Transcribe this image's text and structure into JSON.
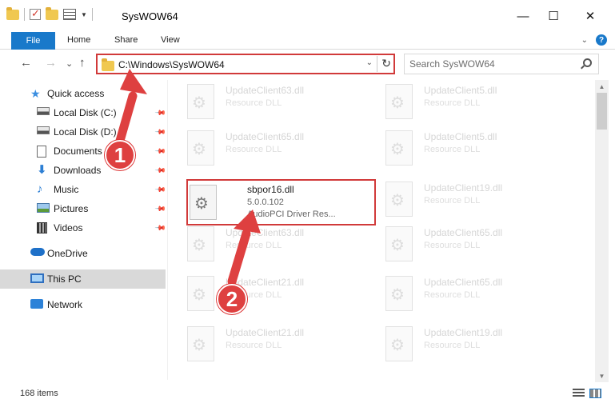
{
  "window": {
    "title": "SysWOW64",
    "minimize": "—",
    "maximize": "☐",
    "close": "✕"
  },
  "ribbon": {
    "tabs": [
      "File",
      "Home",
      "Share",
      "View"
    ],
    "expand": "⌄",
    "help": "?"
  },
  "nav": {
    "back": "←",
    "forward": "→",
    "recent": "⌄",
    "up": "↑",
    "address": "C:\\Windows\\SysWOW64",
    "refresh": "↻",
    "search_placeholder": "Search SysWOW64"
  },
  "sidebar": {
    "items": [
      {
        "label": "Quick access",
        "icon": "star-icon",
        "pinned": false
      },
      {
        "label": "Local Disk (C:)",
        "icon": "disk-icon",
        "pinned": true
      },
      {
        "label": "Local Disk (D:)",
        "icon": "disk-icon",
        "pinned": true
      },
      {
        "label": "Documents",
        "icon": "document-icon",
        "pinned": true
      },
      {
        "label": "Downloads",
        "icon": "download-icon",
        "pinned": true
      },
      {
        "label": "Music",
        "icon": "music-icon",
        "pinned": true
      },
      {
        "label": "Pictures",
        "icon": "pictures-icon",
        "pinned": true
      },
      {
        "label": "Videos",
        "icon": "videos-icon",
        "pinned": true
      },
      {
        "label": "OneDrive",
        "icon": "cloud-icon",
        "pinned": false
      },
      {
        "label": "This PC",
        "icon": "computer-icon",
        "pinned": false,
        "selected": true
      },
      {
        "label": "Network",
        "icon": "network-icon",
        "pinned": false
      }
    ]
  },
  "files": {
    "left": [
      {
        "name": "UpdateClient63.dll",
        "type": "Resource DLL"
      },
      {
        "name": "UpdateClient65.dll",
        "type": "Resource DLL"
      },
      {
        "name": "sbpor16.dll",
        "version": "5.0.0.102",
        "type": "AudioPCI Driver Res...",
        "highlighted": true
      },
      {
        "name": "UpdateClient63.dll",
        "type": "Resource DLL"
      },
      {
        "name": "UpdateClient21.dll",
        "type": "Resource DLL"
      },
      {
        "name": "UpdateClient21.dll",
        "type": "Resource DLL"
      }
    ],
    "right": [
      {
        "name": "UpdateClient5.dll",
        "type": "Resource DLL"
      },
      {
        "name": "UpdateClient5.dll",
        "type": "Resource DLL"
      },
      {
        "name": "UpdateClient19.dll",
        "type": "Resource DLL"
      },
      {
        "name": "UpdateClient65.dll",
        "type": "Resource DLL"
      },
      {
        "name": "UpdateClient65.dll",
        "type": "Resource DLL"
      },
      {
        "name": "UpdateClient19.dll",
        "type": "Resource DLL"
      }
    ]
  },
  "status": {
    "item_count": "168 items"
  },
  "annotations": {
    "step1": "1",
    "step2": "2"
  },
  "colors": {
    "accent": "#1979ca",
    "highlight": "#d13a3a",
    "badge": "#de4040"
  }
}
